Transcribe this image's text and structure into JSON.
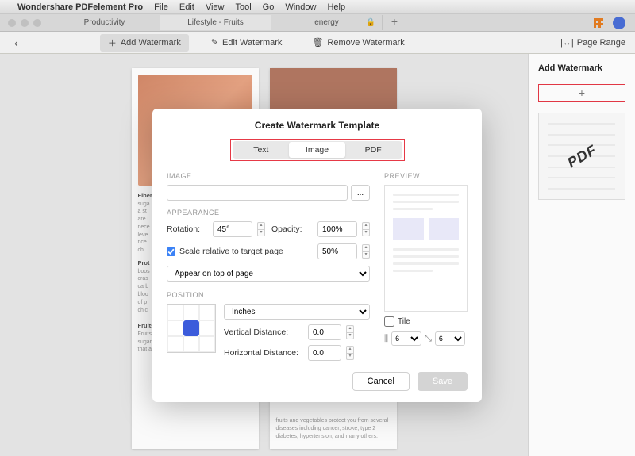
{
  "menubar": {
    "app": "Wondershare PDFelement Pro",
    "items": [
      "File",
      "Edit",
      "View",
      "Tool",
      "Go",
      "Window",
      "Help"
    ]
  },
  "tabs": {
    "items": [
      {
        "label": "Productivity"
      },
      {
        "label": "Lifestyle - Fruits"
      },
      {
        "label": "energy"
      }
    ]
  },
  "toolbar": {
    "add": "Add Watermark",
    "edit": "Edit Watermark",
    "remove": "Remove Watermark",
    "page_range": "Page Range"
  },
  "rpanel": {
    "title": "Add Watermark",
    "thumb_text": "PDF"
  },
  "doc": {
    "p1": {
      "fiber_head": "Fiber",
      "fiber_body": "suga\na st\nare l\nnece\nleve\nrice\nch",
      "protein_head": "Prot",
      "protein_body": "boos\ncras\ncarb\nbloo\nof p\nchic",
      "fruits_head": "Fruits and Vegetables:",
      "fruits_body": "Fruits and vegetables are low in fats and sugar but have enough vitamins and minerals that are good for your health."
    },
    "p2": {
      "body": "fruits and vegetables protect you from several diseases including cancer, stroke, type 2 diabetes, hypertension, and many others."
    }
  },
  "modal": {
    "title": "Create Watermark Template",
    "tabs": {
      "text": "Text",
      "image": "Image",
      "pdf": "PDF"
    },
    "image_label": "IMAGE",
    "browse": "...",
    "appearance_label": "APPEARANCE",
    "rotation_label": "Rotation:",
    "rotation_value": "45°",
    "opacity_label": "Opacity:",
    "opacity_value": "100%",
    "scale_label": "Scale relative to target page",
    "scale_value": "50%",
    "layer_value": "Appear on top of page",
    "position_label": "POSITION",
    "units_value": "Inches",
    "vdist_label": "Vertical Distance:",
    "vdist_value": "0.0",
    "hdist_label": "Horizontal Distance:",
    "hdist_value": "0.0",
    "preview_label": "PREVIEW",
    "tile_label": "Tile",
    "tile_h": "6",
    "tile_v": "6",
    "cancel": "Cancel",
    "save": "Save"
  }
}
